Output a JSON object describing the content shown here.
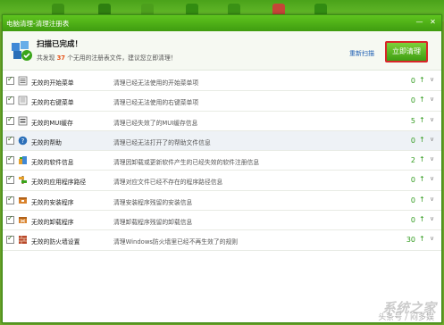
{
  "dialog": {
    "title": "电脑清理-清理注册表",
    "min_icon": "minimize-icon",
    "close_icon": "close-icon"
  },
  "header": {
    "title": "扫描已完成！",
    "subtitle_prefix": "共发现",
    "count": "37",
    "subtitle_suffix": "个无用的注册表文件，建议您立即清理！",
    "rescan_label": "重新扫描",
    "clean_label": "立即清理"
  },
  "rows": [
    {
      "name": "无效的开始菜单",
      "desc": "清理已经无法使用的开始菜单项",
      "count": "0",
      "icon": "start-menu-icon"
    },
    {
      "name": "无效的右键菜单",
      "desc": "清理已经无法使用的右键菜单项",
      "count": "0",
      "icon": "context-menu-icon"
    },
    {
      "name": "无效的MUI缓存",
      "desc": "清理已经失效了的MUI缓存信息",
      "count": "5",
      "icon": "mui-cache-icon"
    },
    {
      "name": "无效的帮助",
      "desc": "清理已经无法打开了的帮助文件信息",
      "count": "0",
      "icon": "help-icon"
    },
    {
      "name": "无效的软件信息",
      "desc": "清理因卸载或更新软件产生的已经失效的软件注册信息",
      "count": "2",
      "icon": "software-info-icon"
    },
    {
      "name": "无效的应用程序路径",
      "desc": "清理对应文件已经不存在的程序路径信息",
      "count": "0",
      "icon": "app-path-icon"
    },
    {
      "name": "无效的安装程序",
      "desc": "清理安装程序残留的安装信息",
      "count": "0",
      "icon": "installer-icon"
    },
    {
      "name": "无效的卸载程序",
      "desc": "清理卸载程序残留的卸载信息",
      "count": "0",
      "icon": "uninstaller-icon"
    },
    {
      "name": "无效的防火墙设置",
      "desc": "清理Windows防火墙里已经不再生效了的规则",
      "count": "30",
      "icon": "firewall-icon"
    }
  ],
  "watermark": "系统之家",
  "watermark_sub": "头条号 / 闷多娱",
  "colors": {
    "accent": "#3f9c10",
    "count": "#2f9a1c",
    "highlight_border": "#d9262a"
  }
}
